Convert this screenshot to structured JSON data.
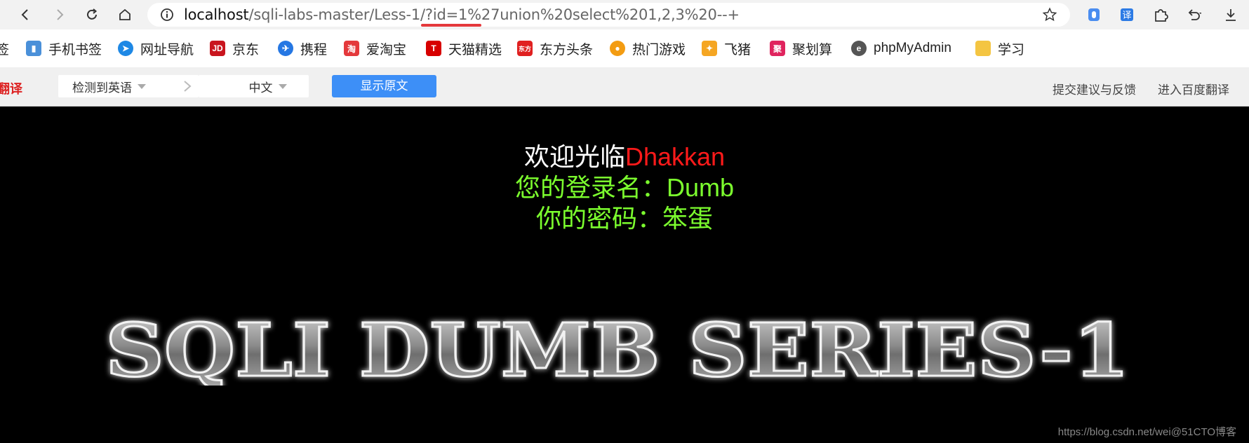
{
  "browser": {
    "url_host": "localhost",
    "url_path": "/sqli-labs-master/Less-1/?id=1%27union%20select%201,2,3%20--+"
  },
  "bookmarks": [
    {
      "label": "签",
      "icon": "bookmark-folder-icon",
      "color": "#999999"
    },
    {
      "label": "手机书签",
      "icon": "phone-bookmark-icon",
      "color": "#4a90d9"
    },
    {
      "label": "网址导航",
      "icon": "navigation-icon",
      "color": "#1e88e5"
    },
    {
      "label": "京东",
      "icon": "jd-icon",
      "color": "#c9151e"
    },
    {
      "label": "携程",
      "icon": "ctrip-icon",
      "color": "#2577e3"
    },
    {
      "label": "爱淘宝",
      "icon": "taobao-icon",
      "color": "#e4393c"
    },
    {
      "label": "天猫精选",
      "icon": "tmall-icon",
      "color": "#d70000"
    },
    {
      "label": "东方头条",
      "icon": "toutiao-icon",
      "color": "#e02020"
    },
    {
      "label": "热门游戏",
      "icon": "game-icon",
      "color": "#f39c12"
    },
    {
      "label": "飞猪",
      "icon": "fliggy-icon",
      "color": "#f5a623"
    },
    {
      "label": "聚划算",
      "icon": "juhuasuan-icon",
      "color": "#e0245e"
    },
    {
      "label": "phpMyAdmin",
      "icon": "phpmyadmin-icon",
      "color": "#555555"
    },
    {
      "label": "学习",
      "icon": "folder-icon",
      "color": "#f4c542"
    }
  ],
  "translate_bar": {
    "logo": "翻译",
    "source_lang": "检测到英语",
    "target_lang": "中文",
    "show_original": "显示原文",
    "feedback": "提交建议与反馈",
    "enter_baidu": "进入百度翻译"
  },
  "page": {
    "welcome_prefix": "欢迎光临",
    "welcome_name": "Dhakkan",
    "login_line": "您的登录名：Dumb",
    "password_line": "你的密码：笨蛋",
    "banner_text": "SQLI DUMB SERIES-1",
    "watermark": "https://blog.csdn.net/wei@51CTO博客"
  },
  "colors": {
    "welcome_name": "#ff1a1a",
    "login_text": "#7cff2e",
    "show_original_bg": "#3d8ff7",
    "url_underline": "#e5383b"
  }
}
